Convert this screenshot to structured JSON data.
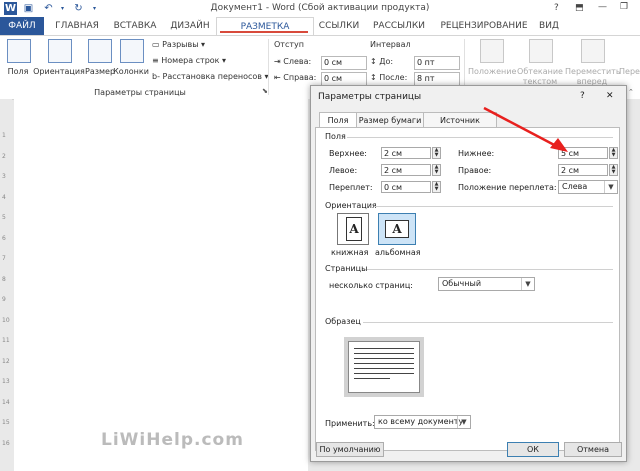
{
  "window": {
    "title": "Документ1 - Word (Сбой активации продукта)",
    "help": "?",
    "minimize": "—",
    "restore": "❐",
    "close": "✕"
  },
  "tabs": [
    "ФАЙЛ",
    "ГЛАВНАЯ",
    "ВСТАВКА",
    "ДИЗАЙН",
    "РАЗМЕТКА СТРАНИЦЫ",
    "ССЫЛКИ",
    "РАССЫЛКИ",
    "РЕЦЕНЗИРОВАНИЕ",
    "ВИД"
  ],
  "ribbon": {
    "margins": "Поля",
    "orientation": "Ориентация",
    "size": "Размер",
    "columns": "Колонки",
    "breaks": "Разрывы",
    "line_numbers": "Номера строк",
    "hyphenation": "Расстановка переносов",
    "group_page_setup": "Параметры страницы",
    "indent_title": "Отступ",
    "indent_left_label": "Слева:",
    "indent_left_value": "0 см",
    "indent_right_label": "Справа:",
    "indent_right_value": "0 см",
    "spacing_title": "Интервал",
    "spacing_before_label": "До:",
    "spacing_before_value": "0 пт",
    "spacing_after_label": "После:",
    "spacing_after_value": "8 пт",
    "position": "Положение",
    "wrap_text_1": "Обтекание",
    "wrap_text_2": "текстом",
    "bring_forward_1": "Переместить",
    "bring_forward_2": "вперед",
    "send_backward": "Перем"
  },
  "ruler_numbers": [
    "1",
    "2",
    "3",
    "4",
    "5",
    "6",
    "7",
    "8",
    "9",
    "10",
    "11",
    "12",
    "13",
    "14",
    "15",
    "16"
  ],
  "watermark": "LiWiHelp.com",
  "dialog": {
    "title": "Параметры страницы",
    "tabs": [
      "Поля",
      "Размер бумаги",
      "Источник бумаги"
    ],
    "section_margins": "Поля",
    "top_label": "Верхнее:",
    "top_value": "2 см",
    "bottom_label": "Нижнее:",
    "bottom_value": "5 см",
    "left_label": "Левое:",
    "left_value": "2 см",
    "right_label": "Правое:",
    "right_value": "2 см",
    "gutter_label": "Переплет:",
    "gutter_value": "0 см",
    "gutter_pos_label": "Положение переплета:",
    "gutter_pos_value": "Слева",
    "section_orientation": "Ориентация",
    "portrait": "книжная",
    "landscape": "альбомная",
    "section_pages": "Страницы",
    "multiple_pages_label": "несколько страниц:",
    "multiple_pages_value": "Обычный",
    "section_preview": "Образец",
    "apply_label": "Применить:",
    "apply_value": "ко всему документу",
    "default_button": "По умолчанию",
    "ok_button": "ОК",
    "cancel_button": "Отмена"
  },
  "colors": {
    "accent": "#2b579a",
    "arrow": "#e8201e"
  }
}
